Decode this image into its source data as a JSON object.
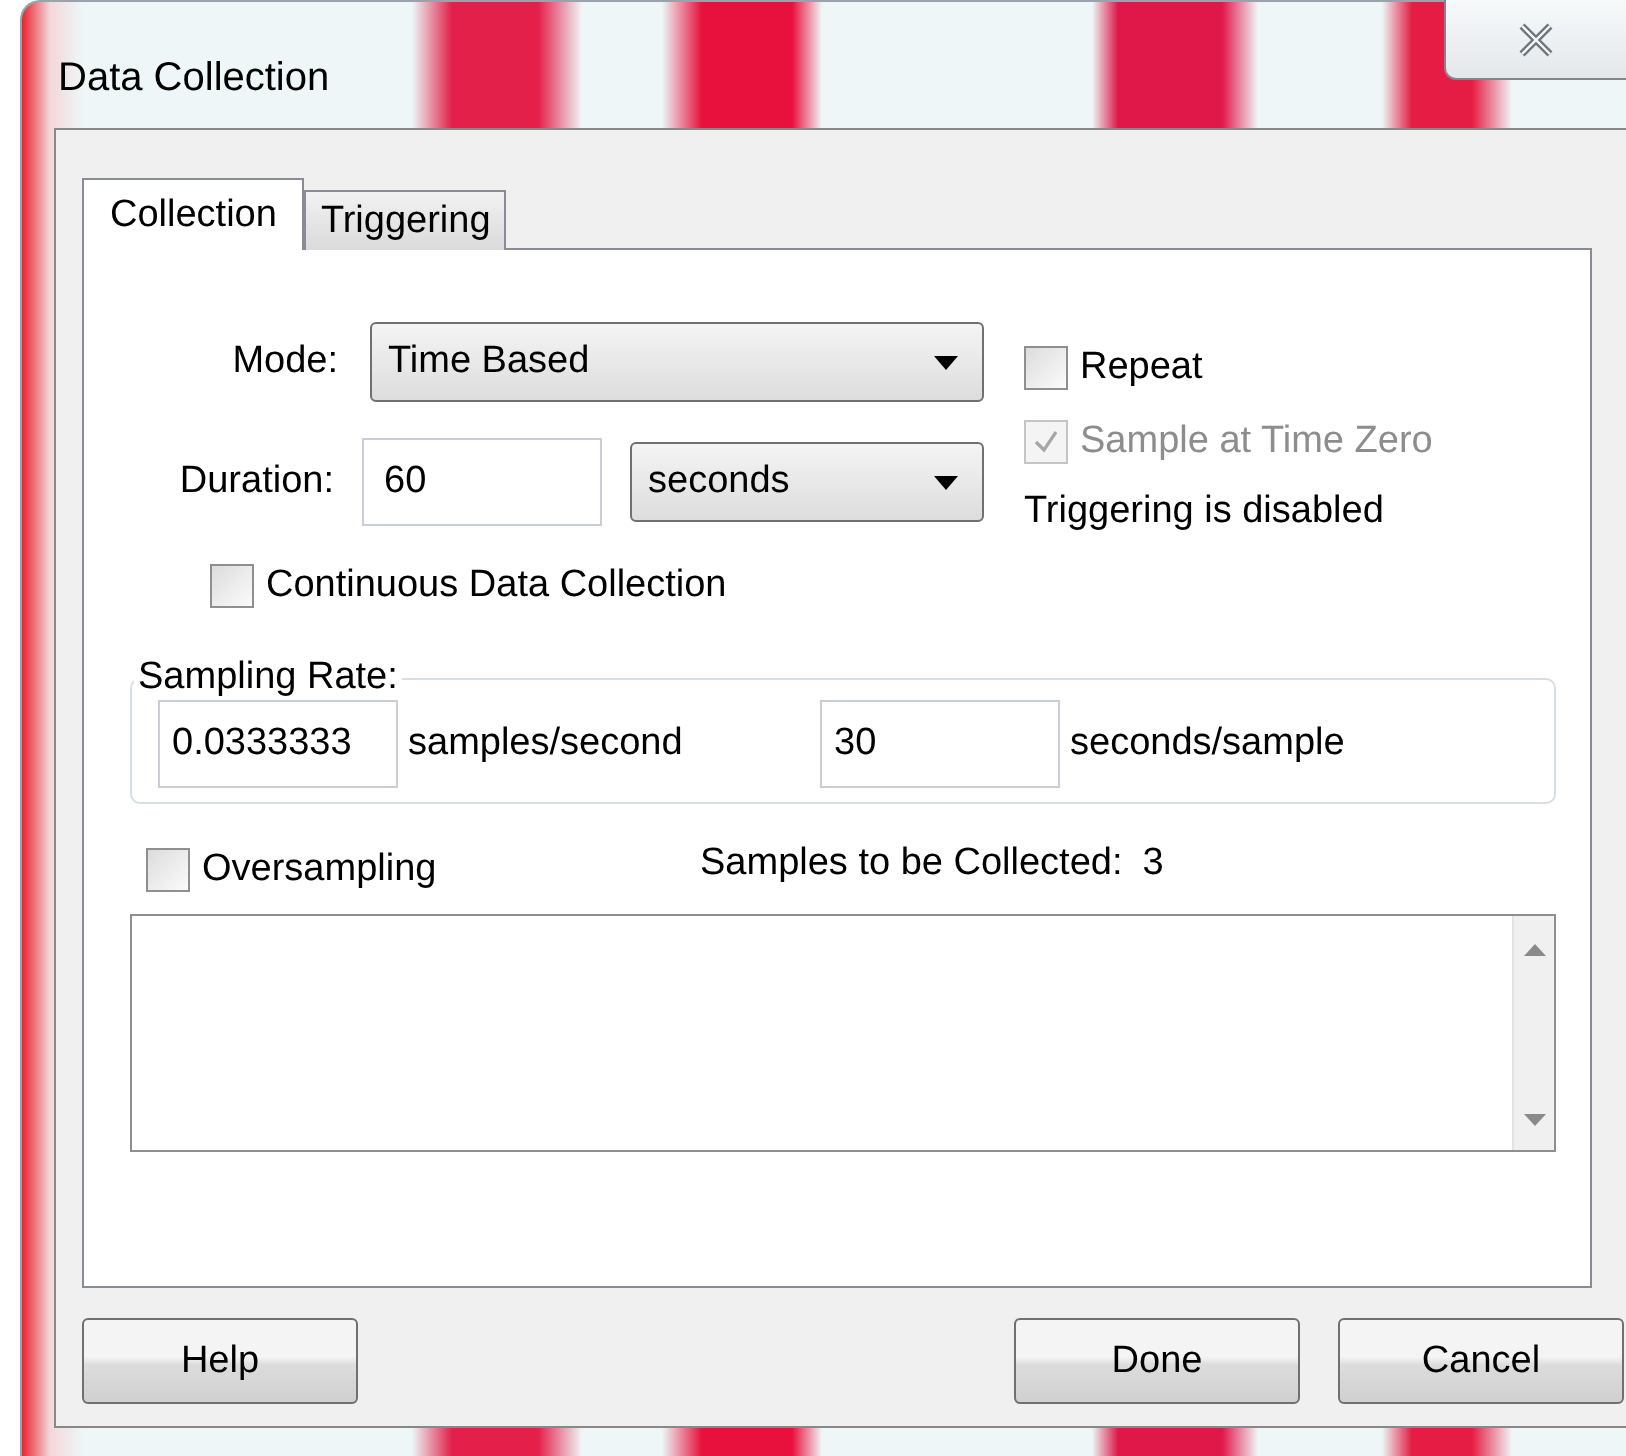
{
  "window": {
    "title": "Data Collection"
  },
  "tabs": [
    {
      "label": "Collection",
      "selected": true
    },
    {
      "label": "Triggering",
      "selected": false
    }
  ],
  "mode": {
    "label": "Mode:",
    "value": "Time Based"
  },
  "duration": {
    "label": "Duration:",
    "value": "60",
    "unit": "seconds"
  },
  "options": [
    {
      "label": "Repeat",
      "checked": false,
      "disabled": false
    },
    {
      "label": "Sample at Time Zero",
      "checked": true,
      "disabled": true
    }
  ],
  "trigger_status": "Triggering is disabled",
  "continuous": {
    "label": "Continuous Data Collection",
    "checked": false
  },
  "sampling_rate": {
    "legend": "Sampling Rate:",
    "rate_value": "0.0333333",
    "rate_unit": "samples/second",
    "period_value": "30",
    "period_unit": "seconds/sample"
  },
  "oversampling": {
    "label": "Oversampling",
    "checked": false
  },
  "samples_to_collect": {
    "label": "Samples to be Collected:",
    "value": "3"
  },
  "buttons_left": [
    "Help"
  ],
  "buttons_right": [
    "Done",
    "Cancel"
  ]
}
